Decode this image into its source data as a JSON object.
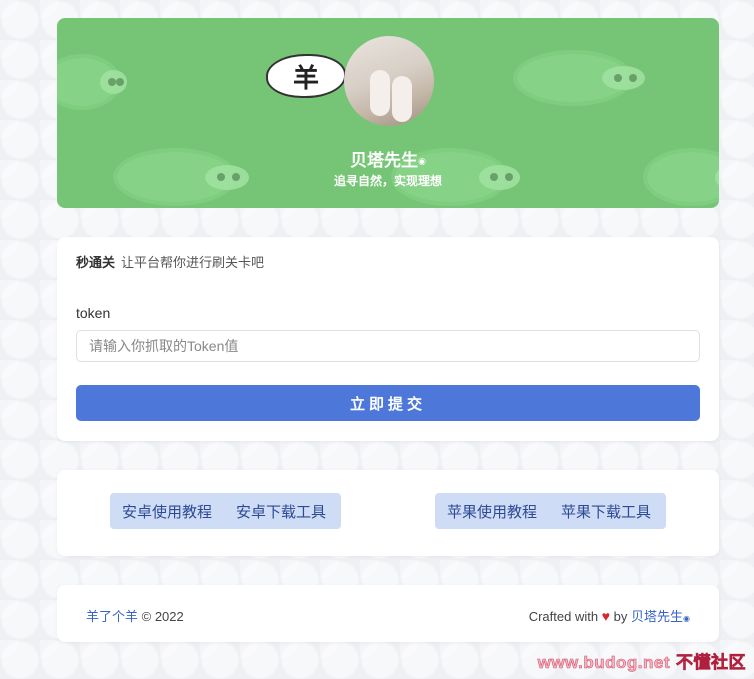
{
  "hero": {
    "logo_char": "羊",
    "name": "贝塔先生",
    "name_mark": "◉",
    "motto": "追寻自然，实现理想"
  },
  "form": {
    "header_title": "秒通关",
    "header_sub": "让平台帮你进行刷关卡吧",
    "field_label": "token",
    "input_placeholder": "请输入你抓取的Token值",
    "input_value": "",
    "submit_label": "立即提交"
  },
  "links": {
    "android_tutorial": "安卓使用教程",
    "android_download": "安卓下载工具",
    "apple_tutorial": "苹果使用教程",
    "apple_download": "苹果下载工具"
  },
  "footer": {
    "brand": "羊了个羊",
    "copyright": "© 2022",
    "crafted": "Crafted with",
    "heart": "♥",
    "by": "by",
    "author": "贝塔先生",
    "author_mark": "◉"
  },
  "watermark": {
    "url": "www.budog.net",
    "label": "不懂社区"
  },
  "colors": {
    "hero_bg": "#76c576",
    "primary": "#4d77d8",
    "link_bg": "#cfdcf6",
    "heart": "#d9242b"
  }
}
